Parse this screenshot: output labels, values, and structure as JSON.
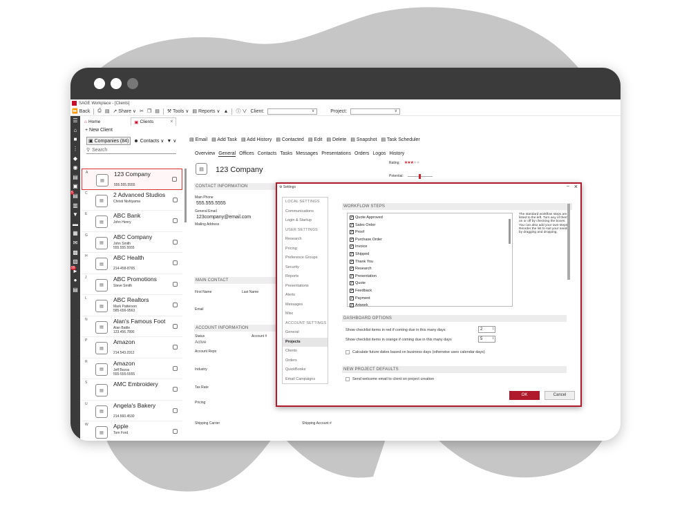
{
  "app": {
    "title": "SAGE Workplace - [Clients]"
  },
  "toolbar": {
    "back": "Back",
    "share": "Share",
    "tools": "Tools",
    "reports": "Reports",
    "client_label": "Client:",
    "client_value": "",
    "project_label": "Project:",
    "project_value": ""
  },
  "tabs": [
    {
      "label": "Home"
    },
    {
      "label": "Clients"
    }
  ],
  "list": {
    "new_client": "New Client",
    "companies": "Companies (84)",
    "contacts": "Contacts",
    "search_placeholder": "Search",
    "clients": [
      {
        "letter": "A",
        "name": "123 Company",
        "line1": "",
        "line2": "555.555.5555",
        "logo": "building-icon"
      },
      {
        "letter": "C",
        "name": "2 Advanced Studios",
        "line1": "Christi Nishiyama",
        "line2": "",
        "logo": "building-icon"
      },
      {
        "letter": "E",
        "name": "ABC Bank",
        "line1": "John Henry",
        "line2": "",
        "logo": "abc-realty-logo"
      },
      {
        "letter": "G",
        "name": "ABC Company",
        "line1": "John Smith",
        "line2": "555.555.5555",
        "logo": "abc-blocks-logo"
      },
      {
        "letter": "H",
        "name": "ABC Health",
        "line1": "",
        "line2": "214-458-8765",
        "logo": "building-icon"
      },
      {
        "letter": "J",
        "name": "ABC Promotions",
        "line1": "Steve Smith",
        "line2": "",
        "logo": "abc-blocks-logo"
      },
      {
        "letter": "L",
        "name": "ABC Realtors",
        "line1": "Mark Patterson",
        "line2": "585-656-9563",
        "logo": "roof-logo"
      },
      {
        "letter": "N",
        "name": "Alan's Famous Foot",
        "line1": "Alan Battle",
        "line2": "123.456.7890",
        "logo": "alans-logo"
      },
      {
        "letter": "P",
        "name": "Amazon",
        "line1": "",
        "line2": "214.543.2312",
        "logo": "building-icon"
      },
      {
        "letter": "R",
        "name": "Amazon",
        "line1": "Jeff Bezos",
        "line2": "555-555-5555",
        "logo": "amazon-logo"
      },
      {
        "letter": "S",
        "name": "AMC Embroidery",
        "line1": "",
        "line2": "",
        "logo": "building-icon"
      },
      {
        "letter": "U",
        "name": "Angela's Bakery",
        "line1": "",
        "line2": "214.560.4530",
        "logo": "building-icon"
      },
      {
        "letter": "W",
        "name": "Apple",
        "line1": "Tom Ford",
        "line2": "",
        "logo": "building-icon"
      }
    ]
  },
  "detail": {
    "actions": [
      "Email",
      "Add Task",
      "Add History",
      "Contacted",
      "Edit",
      "Delete",
      "Snapshot",
      "Task Scheduler"
    ],
    "subtabs": [
      "Overview",
      "General",
      "Offices",
      "Contacts",
      "Tasks",
      "Messages",
      "Presentations",
      "Orders",
      "Logos",
      "History"
    ],
    "company_name": "123 Company",
    "rating_label": "Rating:",
    "rating_stars": 3,
    "potential_label": "Potential:",
    "contact_info": "CONTACT INFORMATION",
    "main_phone_label": "Main Phone",
    "main_phone": "555.555.5555",
    "general_email_label": "General Email",
    "general_email": "123company@email.com",
    "mailing_address_label": "Mailing Address",
    "main_contact": "MAIN CONTACT",
    "first_name_label": "First Name",
    "last_name_label": "Last Name",
    "email_label": "Email",
    "account_info": "ACCOUNT INFORMATION",
    "status_label": "Status",
    "status_value": "Active",
    "account_num_label": "Account #",
    "account_reps_label": "Account Reps",
    "industry_label": "Industry",
    "tax_rate_label": "Tax Rate",
    "pricing_label": "Pricing",
    "shipping_carrier_label": "Shipping Carrier",
    "shipping_account_label": "Shipping Account #"
  },
  "settings": {
    "title": "Settings",
    "nav": [
      {
        "label": "LOCAL SETTINGS",
        "type": "hdr"
      },
      {
        "label": "Communications",
        "type": "item"
      },
      {
        "label": "Login & Startup",
        "type": "item"
      },
      {
        "label": "USER SETTINGS",
        "type": "hdr"
      },
      {
        "label": "Research",
        "type": "item"
      },
      {
        "label": "Pricing",
        "type": "item"
      },
      {
        "label": "Preference Groups",
        "type": "item"
      },
      {
        "label": "Security",
        "type": "item"
      },
      {
        "label": "Reports",
        "type": "item"
      },
      {
        "label": "Presentations",
        "type": "item"
      },
      {
        "label": "Alerts",
        "type": "item"
      },
      {
        "label": "Messages",
        "type": "item"
      },
      {
        "label": "Misc",
        "type": "item"
      },
      {
        "label": "ACCOUNT SETTINGS",
        "type": "hdr"
      },
      {
        "label": "General",
        "type": "item"
      },
      {
        "label": "Projects",
        "type": "active"
      },
      {
        "label": "Clients",
        "type": "item"
      },
      {
        "label": "Orders",
        "type": "item"
      },
      {
        "label": "QuickBooks",
        "type": "item"
      },
      {
        "label": "Email Campaigns",
        "type": "item"
      }
    ],
    "workflow_header": "WORKFLOW STEPS",
    "steps": [
      "Quote Approved",
      "Sales Order",
      "Proof",
      "Purchase Order",
      "Invoice",
      "Shipped",
      "Thank You",
      "Research",
      "Presentation",
      "Quote",
      "Feedback",
      "Payment",
      "Artwork"
    ],
    "steps_help": "The standard workflow steps are listed to the left. Turn any of them on or off by checking the boxes. You can also add your own steps. Reorder the list to suit your needs by dragging and dropping.",
    "dashboard_header": "DASHBOARD OPTIONS",
    "red_label": "Show checklist items in red if coming due in this many days",
    "red_value": "2",
    "orange_label": "Show checklist items in orange if coming due in this many days",
    "orange_value": "5",
    "business_days_label": "Calculate future dates based on business days (otherwise uses calendar days)",
    "defaults_header": "NEW PROJECT DEFAULTS",
    "welcome_label": "Send welcome email to client on project creation",
    "ok": "OK",
    "cancel": "Cancel"
  },
  "colors": {
    "accent": "#b0192b",
    "rail": "#3a3a3a",
    "frame": "#3b3b3c",
    "blob": "#c4c4c4"
  }
}
